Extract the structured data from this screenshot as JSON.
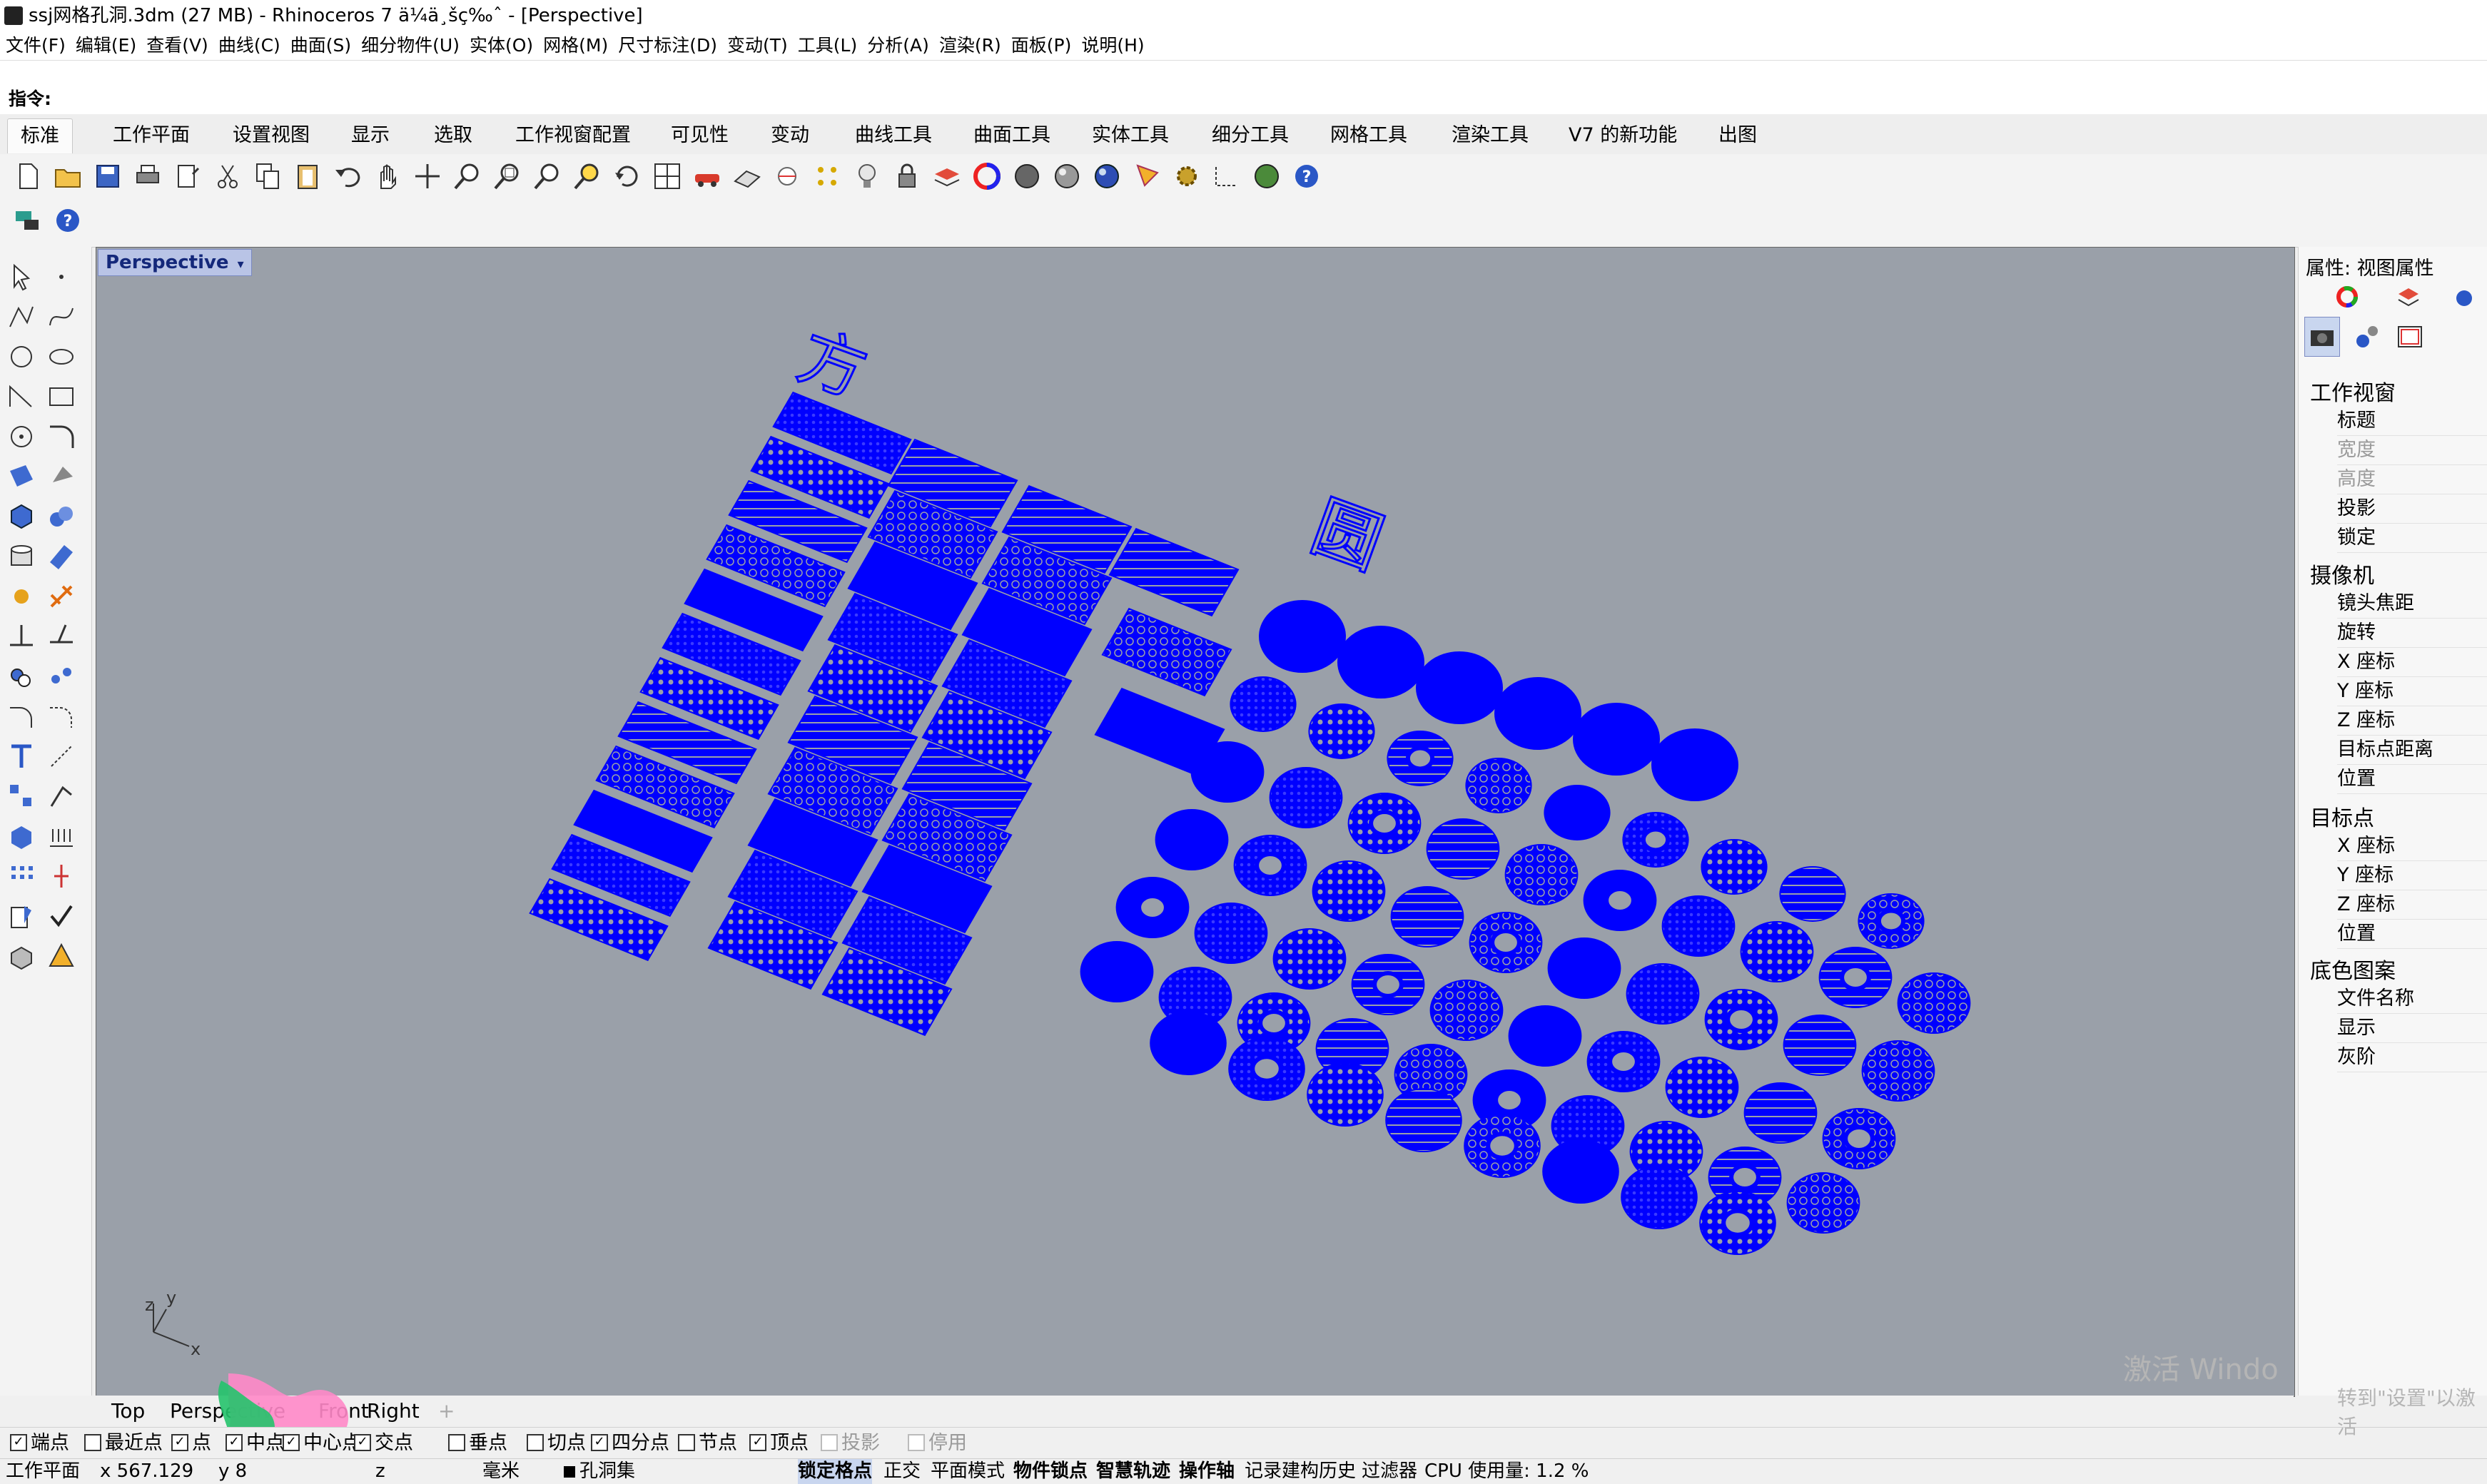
{
  "window": {
    "title": "ssj网格孔洞.3dm (27 MB) - Rhinoceros 7 ä¼ä¸šç‰ˆ - [Perspective]"
  },
  "menu": [
    "文件(F)",
    "编辑(E)",
    "查看(V)",
    "曲线(C)",
    "曲面(S)",
    "细分物件(U)",
    "实体(O)",
    "网格(M)",
    "尺寸标注(D)",
    "变动(T)",
    "工具(L)",
    "分析(A)",
    "渲染(R)",
    "面板(P)",
    "说明(H)"
  ],
  "command": {
    "prompt": "指令:"
  },
  "tabs": [
    "标准",
    "工作平面",
    "设置视图",
    "显示",
    "选取",
    "工作视窗配置",
    "可见性",
    "变动",
    "曲线工具",
    "曲面工具",
    "实体工具",
    "细分工具",
    "网格工具",
    "渲染工具",
    "V7 的新功能",
    "出图"
  ],
  "viewport": {
    "title": "Perspective",
    "label_square": "方",
    "label_circle": "圆",
    "axis_labels": [
      "z",
      "y",
      "x"
    ],
    "mesh_color": "#0000ff",
    "background_color": "#9aa0a9"
  },
  "viewport_tabs": [
    "Top",
    "Perspective",
    "Front",
    "Right"
  ],
  "osnaps": [
    {
      "label": "端点",
      "checked": true,
      "enabled": true
    },
    {
      "label": "最近点",
      "checked": false,
      "enabled": true
    },
    {
      "label": "点",
      "checked": true,
      "enabled": true
    },
    {
      "label": "中点",
      "checked": true,
      "enabled": true
    },
    {
      "label": "中心点",
      "checked": true,
      "enabled": true
    },
    {
      "label": "交点",
      "checked": true,
      "enabled": true
    },
    {
      "label": "垂点",
      "checked": false,
      "enabled": true
    },
    {
      "label": "切点",
      "checked": false,
      "enabled": true
    },
    {
      "label": "四分点",
      "checked": true,
      "enabled": true
    },
    {
      "label": "节点",
      "checked": false,
      "enabled": true
    },
    {
      "label": "顶点",
      "checked": true,
      "enabled": true
    },
    {
      "label": "投影",
      "checked": false,
      "enabled": false
    },
    {
      "label": "停用",
      "checked": false,
      "enabled": false
    }
  ],
  "status": {
    "cplane": "工作平面",
    "x": "x 567.129",
    "y": "y 8",
    "z": "z",
    "units": "毫米",
    "layer": "孔洞集",
    "grid_snap": "锁定格点",
    "ortho": "正交",
    "planar": "平面模式",
    "osnap": "物件锁点",
    "smarttrack": "智慧轨迹",
    "gumball": "操作轴",
    "history": "记录建构历史",
    "filter": "过滤器",
    "cpu": "CPU 使用量: 1.2 %"
  },
  "panel": {
    "title": "属性: 视图属性",
    "sections": [
      {
        "name": "工作视窗",
        "items": [
          {
            "label": "标题",
            "dim": false
          },
          {
            "label": "宽度",
            "dim": true
          },
          {
            "label": "高度",
            "dim": true
          },
          {
            "label": "投影",
            "dim": false
          },
          {
            "label": "锁定",
            "dim": false
          }
        ]
      },
      {
        "name": "摄像机",
        "items": [
          {
            "label": "镜头焦距",
            "dim": false
          },
          {
            "label": "旋转",
            "dim": false
          },
          {
            "label": "X 座标",
            "dim": false
          },
          {
            "label": "Y 座标",
            "dim": false
          },
          {
            "label": "Z 座标",
            "dim": false
          },
          {
            "label": "目标点距离",
            "dim": false
          },
          {
            "label": "位置",
            "dim": false
          }
        ]
      },
      {
        "name": "目标点",
        "items": [
          {
            "label": "X 座标",
            "dim": false
          },
          {
            "label": "Y 座标",
            "dim": false
          },
          {
            "label": "Z 座标",
            "dim": false
          },
          {
            "label": "位置",
            "dim": false
          }
        ]
      },
      {
        "name": "底色图案",
        "items": [
          {
            "label": "文件名称",
            "dim": false
          },
          {
            "label": "显示",
            "dim": false
          },
          {
            "label": "灰阶",
            "dim": false
          }
        ]
      }
    ]
  },
  "watermark": {
    "line1": "激活 Windo",
    "line2": "转到\"设置\"以激活"
  }
}
